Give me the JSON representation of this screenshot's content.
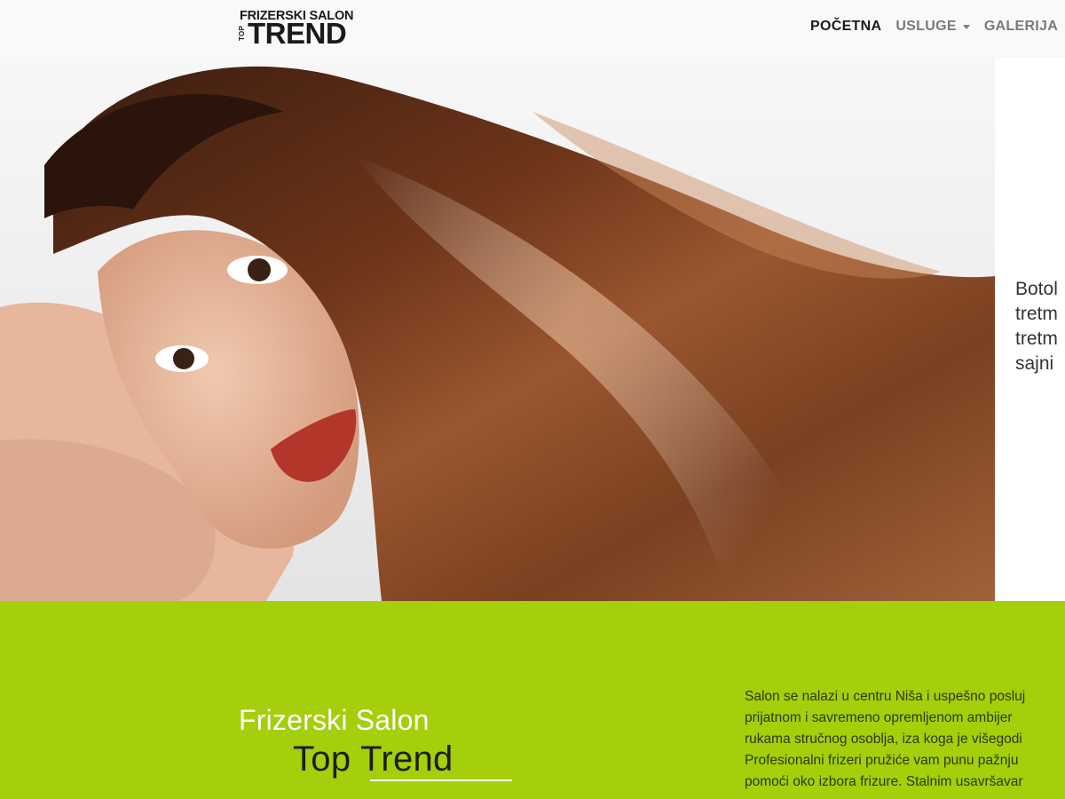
{
  "header": {
    "logo": {
      "line1": "FRIZERSKI SALON",
      "vertical": "TOP",
      "big": "TREND"
    },
    "nav": [
      {
        "label": "POČETNA",
        "active": true,
        "dropdown": false
      },
      {
        "label": "USLUGE",
        "active": false,
        "dropdown": true
      },
      {
        "label": "GALERIJA",
        "active": false,
        "dropdown": false
      }
    ]
  },
  "hero": {
    "text_lines": [
      "Botol",
      "tretm",
      "tretm",
      "sajni"
    ]
  },
  "about": {
    "title_line1": "Frizerski Salon",
    "title_line2": "Top Trend",
    "text_lines": [
      "Salon se nalazi u centru Niša i uspešno posluj",
      "prijatnom i savremeno opremljenom ambijer",
      "rukama stručnog osoblja, iza koga je višegodi",
      "Profesionalni frizeri pružiće vam punu pažnju",
      "pomoći oko izbora frizure. Stalnim usavršavar"
    ]
  },
  "colors": {
    "accent_green": "#a4cf0b",
    "navbar_bg": "#f8f9fa",
    "nav_active": "#1c1c1c",
    "nav_inactive": "#7a7a7a"
  }
}
